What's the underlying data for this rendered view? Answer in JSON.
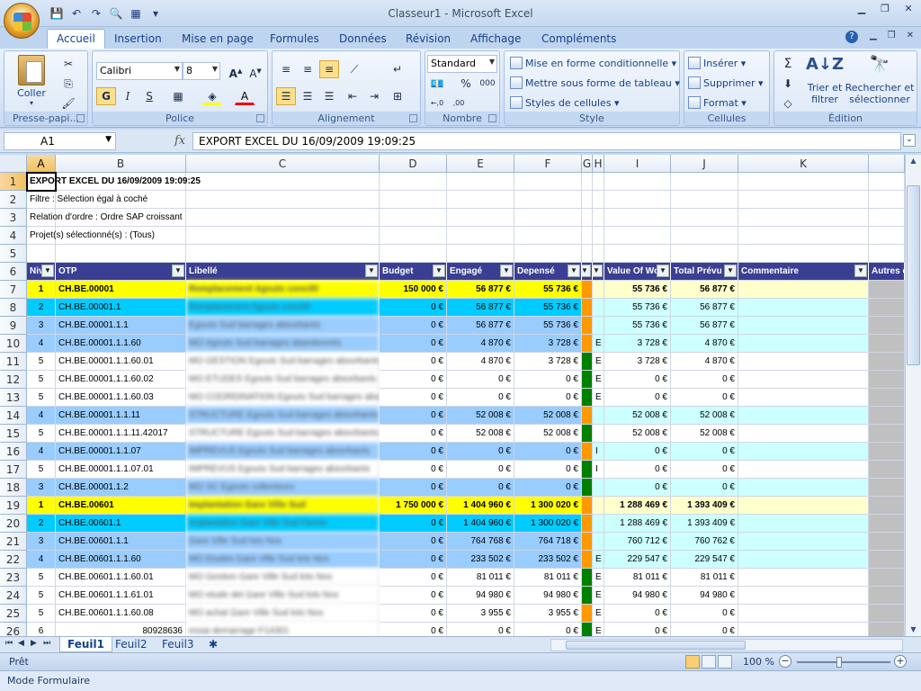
{
  "window": {
    "title": "Classeur1 - Microsoft Excel"
  },
  "ribbon": {
    "tabs": [
      "Accueil",
      "Insertion",
      "Mise en page",
      "Formules",
      "Données",
      "Révision",
      "Affichage",
      "Compléments"
    ],
    "clipboard": {
      "paste": "Coller",
      "label": "Presse-papi..."
    },
    "font": {
      "name": "Calibri",
      "size": "8",
      "label": "Police"
    },
    "alignment": {
      "label": "Alignement"
    },
    "number": {
      "format": "Standard",
      "label": "Nombre"
    },
    "style": {
      "cond": "Mise en forme conditionnelle",
      "table": "Mettre sous forme de tableau",
      "cellstyles": "Styles de cellules",
      "label": "Style"
    },
    "cells": {
      "insert": "Insérer",
      "delete": "Supprimer",
      "format": "Format",
      "label": "Cellules"
    },
    "edit": {
      "sort1": "Trier et",
      "sort2": "filtrer",
      "find1": "Rechercher et",
      "find2": "sélectionner",
      "label": "Édition"
    }
  },
  "formula_bar": {
    "name_box": "A1",
    "fx": "fx",
    "formula": "EXPORT EXCEL DU 16/09/2009 19:09:25"
  },
  "sheet": {
    "columns": [
      "A",
      "B",
      "C",
      "D",
      "E",
      "F",
      "G",
      "H",
      "I",
      "J",
      "K"
    ],
    "header_labels": [
      "Niv",
      "OTP",
      "Libellé",
      "Budget",
      "Engagé",
      "Depensé",
      "",
      "",
      "Value Of Wo",
      "Total Prévu",
      "Commentaire",
      "Autres c"
    ],
    "meta_rows": [
      "EXPORT EXCEL DU 16/09/2009 19:09:25",
      "Filtre : Sélection égal à coché",
      "Relation d'ordre : Ordre SAP croissant",
      "Projet(s) sélectionné(s) : (Tous)"
    ],
    "rows": [
      {
        "n": "7",
        "niv": "1",
        "otp": "CH.BE.00001",
        "lib": "Remplacement égouts conc00",
        "budget": "150 000 €",
        "eng": "56 877 €",
        "dep": "55 736 €",
        "h": "",
        "vow": "55 736 €",
        "tp": "56 877 €",
        "style": "y",
        "g": "o"
      },
      {
        "n": "8",
        "niv": "2",
        "otp": "CH.BE.00001.1",
        "lib": "Remplacement égouts conc00",
        "budget": "0 €",
        "eng": "56 877 €",
        "dep": "55 736 €",
        "h": "",
        "vow": "55 736 €",
        "tp": "56 877 €",
        "style": "c",
        "g": "o"
      },
      {
        "n": "9",
        "niv": "3",
        "otp": "CH.BE.00001.1.1",
        "lib": "Egouts Sud barrages absorbants",
        "budget": "0 €",
        "eng": "56 877 €",
        "dep": "55 736 €",
        "h": "",
        "vow": "55 736 €",
        "tp": "56 877 €",
        "style": "b",
        "g": "o"
      },
      {
        "n": "10",
        "niv": "4",
        "otp": "CH.BE.00001.1.1.60",
        "lib": "MO égouts Sud barrages abandonnés",
        "budget": "0 €",
        "eng": "4 870 €",
        "dep": "3 728 €",
        "h": "E",
        "vow": "3 728 €",
        "tp": "4 870 €",
        "style": "b",
        "g": "o"
      },
      {
        "n": "11",
        "niv": "5",
        "otp": "CH.BE.00001.1.1.60.01",
        "lib": "MO GESTION Egouts Sud barrages absorbants",
        "budget": "0 €",
        "eng": "4 870 €",
        "dep": "3 728 €",
        "h": "E",
        "vow": "3 728 €",
        "tp": "4 870 €",
        "style": "w",
        "g": "g"
      },
      {
        "n": "12",
        "niv": "5",
        "otp": "CH.BE.00001.1.1.60.02",
        "lib": "MO ETUDES Egouts Sud barrages absorbants",
        "budget": "0 €",
        "eng": "0 €",
        "dep": "0 €",
        "h": "E",
        "vow": "0 €",
        "tp": "0 €",
        "style": "w",
        "g": "g"
      },
      {
        "n": "13",
        "niv": "5",
        "otp": "CH.BE.00001.1.1.60.03",
        "lib": "MO COORDINATION Egouts Sud barrages absor",
        "budget": "0 €",
        "eng": "0 €",
        "dep": "0 €",
        "h": "E",
        "vow": "0 €",
        "tp": "0 €",
        "style": "w",
        "g": "g"
      },
      {
        "n": "14",
        "niv": "4",
        "otp": "CH.BE.00001.1.1.11",
        "lib": "STRUCTURE Egouts Sud barrages absorbants",
        "budget": "0 €",
        "eng": "52 008 €",
        "dep": "52 008 €",
        "h": "",
        "vow": "52 008 €",
        "tp": "52 008 €",
        "style": "b",
        "g": "o"
      },
      {
        "n": "15",
        "niv": "5",
        "otp": "CH.BE.00001.1.1.11.42017",
        "lib": "STRUCTURE Egouts Sud barrages absorbants",
        "budget": "0 €",
        "eng": "52 008 €",
        "dep": "52 008 €",
        "h": "",
        "vow": "52 008 €",
        "tp": "52 008 €",
        "style": "w",
        "g": "g"
      },
      {
        "n": "16",
        "niv": "4",
        "otp": "CH.BE.00001.1.1.07",
        "lib": "IMPREVUS Egouts Sud barrages absorbants",
        "budget": "0 €",
        "eng": "0 €",
        "dep": "0 €",
        "h": "I",
        "vow": "0 €",
        "tp": "0 €",
        "style": "b",
        "g": "o"
      },
      {
        "n": "17",
        "niv": "5",
        "otp": "CH.BE.00001.1.1.07.01",
        "lib": "IMPREVUS Egouts Sud barrages absorbants",
        "budget": "0 €",
        "eng": "0 €",
        "dep": "0 €",
        "h": "I",
        "vow": "0 €",
        "tp": "0 €",
        "style": "w",
        "g": "g"
      },
      {
        "n": "18",
        "niv": "3",
        "otp": "CH.BE.00001.1.2",
        "lib": "MO SC Egouts collecteurs",
        "budget": "0 €",
        "eng": "0 €",
        "dep": "0 €",
        "h": "",
        "vow": "0 €",
        "tp": "0 €",
        "style": "b",
        "g": "g"
      },
      {
        "n": "19",
        "niv": "1",
        "otp": "CH.BE.00601",
        "lib": "Implantation Gare Ville Sud",
        "budget": "1 750 000 €",
        "eng": "1 404 960 €",
        "dep": "1 300 020 €",
        "h": "",
        "vow": "1 288 469 €",
        "tp": "1 393 409 €",
        "style": "y",
        "g": "o"
      },
      {
        "n": "20",
        "niv": "2",
        "otp": "CH.BE.00601.1",
        "lib": "Implantation Gare Ville Sud Ferme",
        "budget": "0 €",
        "eng": "1 404 960 €",
        "dep": "1 300 020 €",
        "h": "",
        "vow": "1 288 469 €",
        "tp": "1 393 409 €",
        "style": "c",
        "g": "o"
      },
      {
        "n": "21",
        "niv": "3",
        "otp": "CH.BE.00601.1.1",
        "lib": "Gare Ville Sud lots Nox",
        "budget": "0 €",
        "eng": "764 768 €",
        "dep": "764 718 €",
        "h": "",
        "vow": "760 712 €",
        "tp": "760 762 €",
        "style": "b",
        "g": "o"
      },
      {
        "n": "22",
        "niv": "4",
        "otp": "CH.BE.00601.1.1.60",
        "lib": "MO Etudes Gare Ville Sud lots Nox",
        "budget": "0 €",
        "eng": "233 502 €",
        "dep": "233 502 €",
        "h": "E",
        "vow": "229 547 €",
        "tp": "229 547 €",
        "style": "b",
        "g": "o"
      },
      {
        "n": "23",
        "niv": "5",
        "otp": "CH.BE.00601.1.1.60.01",
        "lib": "MO Gestion Gare Ville Sud lots Nox",
        "budget": "0 €",
        "eng": "81 011 €",
        "dep": "81 011 €",
        "h": "E",
        "vow": "81 011 €",
        "tp": "81 011 €",
        "style": "w",
        "g": "g"
      },
      {
        "n": "24",
        "niv": "5",
        "otp": "CH.BE.00601.1.1.61.01",
        "lib": "MO etude det Gare Ville Sud lots Nox",
        "budget": "0 €",
        "eng": "94 980 €",
        "dep": "94 980 €",
        "h": "E",
        "vow": "94 980 €",
        "tp": "94 980 €",
        "style": "w",
        "g": "g"
      },
      {
        "n": "25",
        "niv": "5",
        "otp": "CH.BE.00601.1.1.60.08",
        "lib": "MO achat Gare Ville Sud lots Nox",
        "budget": "0 €",
        "eng": "3 955 €",
        "dep": "3 955 €",
        "h": "E",
        "vow": "0 €",
        "tp": "0 €",
        "style": "w",
        "g": "o"
      },
      {
        "n": "26",
        "niv": "6",
        "otp": "80928636",
        "lib": "essai demarrage F14301",
        "budget": "0 €",
        "eng": "0 €",
        "dep": "0 €",
        "h": "E",
        "vow": "0 €",
        "tp": "0 €",
        "style": "w",
        "g": "g",
        "otp_right": true
      }
    ],
    "sheets": [
      "Feuil1",
      "Feuil2",
      "Feuil3"
    ]
  },
  "status": {
    "ready": "Prêt",
    "zoom": "100 %",
    "mode": "Mode Formulaire"
  },
  "colors": {
    "yellow": "#ffff00",
    "cyan": "#00ccff",
    "lightblue": "#99ccff",
    "paleyellow": "#ffffcc",
    "palecyan": "#ccffff",
    "header": "#3b3f93",
    "orange": "#ff9900",
    "green": "#008000"
  }
}
